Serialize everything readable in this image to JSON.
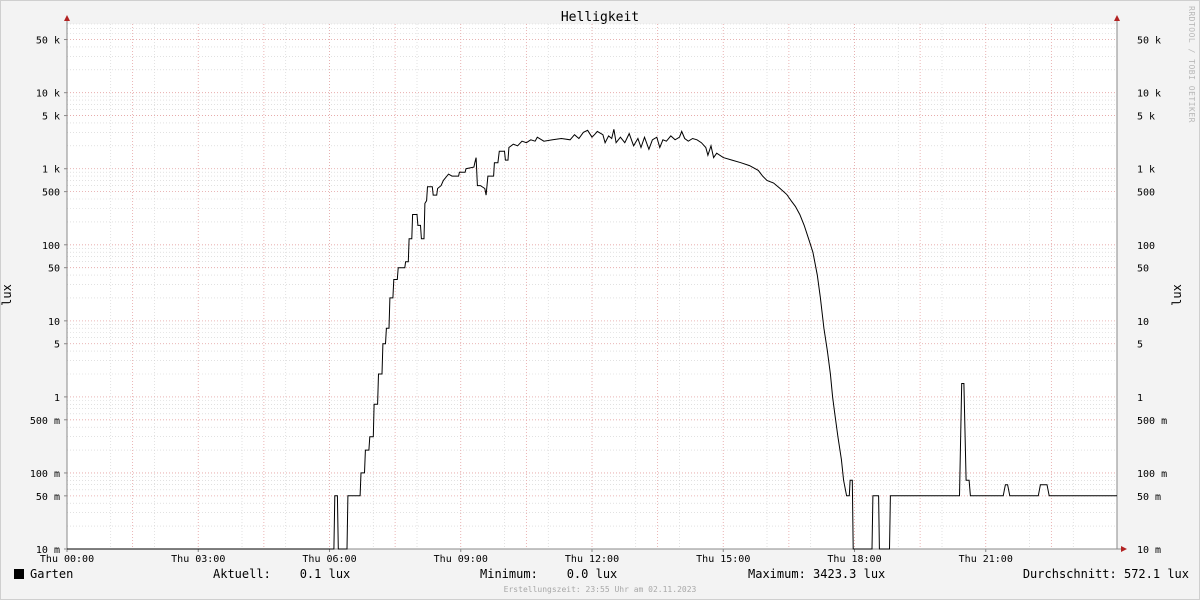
{
  "chart_data": {
    "type": "line",
    "title": "Helligkeit",
    "ylabel": "lux",
    "xlabel": "",
    "yscale": "log",
    "ylim": [
      0.01,
      80000
    ],
    "xlim": [
      0,
      24
    ],
    "x_ticks": [
      {
        "x": 0,
        "label": "Thu 00:00"
      },
      {
        "x": 3,
        "label": "Thu 03:00"
      },
      {
        "x": 6,
        "label": "Thu 06:00"
      },
      {
        "x": 9,
        "label": "Thu 09:00"
      },
      {
        "x": 12,
        "label": "Thu 12:00"
      },
      {
        "x": 15,
        "label": "Thu 15:00"
      },
      {
        "x": 18,
        "label": "Thu 18:00"
      },
      {
        "x": 21,
        "label": "Thu 21:00"
      }
    ],
    "y_ticks": [
      {
        "v": 0.01,
        "label": "10 m"
      },
      {
        "v": 0.05,
        "label": "50 m"
      },
      {
        "v": 0.1,
        "label": "100 m"
      },
      {
        "v": 0.5,
        "label": "500 m"
      },
      {
        "v": 1,
        "label": "1"
      },
      {
        "v": 5,
        "label": "5"
      },
      {
        "v": 10,
        "label": "10"
      },
      {
        "v": 50,
        "label": "50"
      },
      {
        "v": 100,
        "label": "100"
      },
      {
        "v": 500,
        "label": "500"
      },
      {
        "v": 1000,
        "label": "1 k"
      },
      {
        "v": 5000,
        "label": "5 k"
      },
      {
        "v": 10000,
        "label": "10 k"
      },
      {
        "v": 50000,
        "label": "50 k"
      }
    ],
    "grid": true,
    "series": [
      {
        "name": "Garten",
        "color": "#000000",
        "points": [
          [
            0.0,
            0.01
          ],
          [
            6.1,
            0.01
          ],
          [
            6.12,
            0.05
          ],
          [
            6.18,
            0.05
          ],
          [
            6.2,
            0.01
          ],
          [
            6.4,
            0.01
          ],
          [
            6.42,
            0.05
          ],
          [
            6.7,
            0.05
          ],
          [
            6.72,
            0.1
          ],
          [
            6.8,
            0.1
          ],
          [
            6.82,
            0.2
          ],
          [
            6.9,
            0.2
          ],
          [
            6.92,
            0.3
          ],
          [
            7.0,
            0.3
          ],
          [
            7.02,
            0.8
          ],
          [
            7.1,
            0.8
          ],
          [
            7.12,
            2
          ],
          [
            7.2,
            2
          ],
          [
            7.22,
            5
          ],
          [
            7.28,
            5
          ],
          [
            7.3,
            8
          ],
          [
            7.36,
            8
          ],
          [
            7.38,
            20
          ],
          [
            7.45,
            20
          ],
          [
            7.47,
            35
          ],
          [
            7.55,
            35
          ],
          [
            7.57,
            50
          ],
          [
            7.72,
            50
          ],
          [
            7.74,
            60
          ],
          [
            7.8,
            60
          ],
          [
            7.82,
            120
          ],
          [
            7.88,
            120
          ],
          [
            7.9,
            250
          ],
          [
            8.0,
            250
          ],
          [
            8.02,
            180
          ],
          [
            8.08,
            180
          ],
          [
            8.1,
            120
          ],
          [
            8.16,
            120
          ],
          [
            8.18,
            350
          ],
          [
            8.22,
            380
          ],
          [
            8.24,
            580
          ],
          [
            8.35,
            580
          ],
          [
            8.37,
            450
          ],
          [
            8.45,
            450
          ],
          [
            8.47,
            550
          ],
          [
            8.55,
            600
          ],
          [
            8.6,
            700
          ],
          [
            8.72,
            850
          ],
          [
            8.8,
            800
          ],
          [
            8.95,
            800
          ],
          [
            8.97,
            900
          ],
          [
            9.1,
            900
          ],
          [
            9.12,
            1000
          ],
          [
            9.3,
            1050
          ],
          [
            9.32,
            1200
          ],
          [
            9.35,
            1400
          ],
          [
            9.38,
            600
          ],
          [
            9.45,
            600
          ],
          [
            9.55,
            550
          ],
          [
            9.58,
            450
          ],
          [
            9.62,
            800
          ],
          [
            9.75,
            800
          ],
          [
            9.77,
            1200
          ],
          [
            9.85,
            1200
          ],
          [
            9.88,
            1700
          ],
          [
            10.0,
            1700
          ],
          [
            10.02,
            1300
          ],
          [
            10.08,
            1300
          ],
          [
            10.1,
            1900
          ],
          [
            10.2,
            2100
          ],
          [
            10.3,
            2000
          ],
          [
            10.4,
            2300
          ],
          [
            10.5,
            2200
          ],
          [
            10.6,
            2400
          ],
          [
            10.7,
            2300
          ],
          [
            10.75,
            2600
          ],
          [
            10.9,
            2300
          ],
          [
            11.1,
            2400
          ],
          [
            11.3,
            2500
          ],
          [
            11.5,
            2400
          ],
          [
            11.6,
            2800
          ],
          [
            11.7,
            2500
          ],
          [
            11.8,
            3000
          ],
          [
            11.9,
            3200
          ],
          [
            12.0,
            2600
          ],
          [
            12.08,
            2900
          ],
          [
            12.12,
            3100
          ],
          [
            12.25,
            2800
          ],
          [
            12.3,
            2200
          ],
          [
            12.38,
            2700
          ],
          [
            12.45,
            2500
          ],
          [
            12.5,
            3300
          ],
          [
            12.55,
            2200
          ],
          [
            12.65,
            2600
          ],
          [
            12.75,
            2200
          ],
          [
            12.85,
            2900
          ],
          [
            12.95,
            2000
          ],
          [
            13.05,
            2500
          ],
          [
            13.12,
            1900
          ],
          [
            13.2,
            2600
          ],
          [
            13.3,
            1800
          ],
          [
            13.38,
            2400
          ],
          [
            13.48,
            2600
          ],
          [
            13.55,
            1900
          ],
          [
            13.62,
            2400
          ],
          [
            13.7,
            2300
          ],
          [
            13.8,
            2700
          ],
          [
            13.9,
            2400
          ],
          [
            14.0,
            2600
          ],
          [
            14.05,
            3100
          ],
          [
            14.12,
            2500
          ],
          [
            14.2,
            2300
          ],
          [
            14.3,
            2500
          ],
          [
            14.4,
            2400
          ],
          [
            14.5,
            2200
          ],
          [
            14.6,
            1900
          ],
          [
            14.65,
            1500
          ],
          [
            14.72,
            2000
          ],
          [
            14.78,
            1400
          ],
          [
            14.85,
            1600
          ],
          [
            15.0,
            1400
          ],
          [
            15.2,
            1300
          ],
          [
            15.4,
            1200
          ],
          [
            15.6,
            1100
          ],
          [
            15.8,
            950
          ],
          [
            15.9,
            800
          ],
          [
            16.0,
            700
          ],
          [
            16.15,
            650
          ],
          [
            16.3,
            550
          ],
          [
            16.45,
            460
          ],
          [
            16.55,
            380
          ],
          [
            16.65,
            320
          ],
          [
            16.75,
            250
          ],
          [
            16.85,
            180
          ],
          [
            16.95,
            120
          ],
          [
            17.05,
            80
          ],
          [
            17.15,
            40
          ],
          [
            17.22,
            20
          ],
          [
            17.3,
            8
          ],
          [
            17.38,
            4
          ],
          [
            17.45,
            2
          ],
          [
            17.5,
            1
          ],
          [
            17.55,
            0.6
          ],
          [
            17.62,
            0.3
          ],
          [
            17.7,
            0.15
          ],
          [
            17.75,
            0.08
          ],
          [
            17.82,
            0.05
          ],
          [
            17.88,
            0.05
          ],
          [
            17.9,
            0.08
          ],
          [
            17.95,
            0.08
          ],
          [
            17.97,
            0.01
          ],
          [
            18.4,
            0.01
          ],
          [
            18.42,
            0.05
          ],
          [
            18.55,
            0.05
          ],
          [
            18.57,
            0.01
          ],
          [
            18.8,
            0.01
          ],
          [
            18.82,
            0.05
          ],
          [
            20.4,
            0.05
          ],
          [
            20.45,
            1.5
          ],
          [
            20.5,
            1.5
          ],
          [
            20.55,
            0.08
          ],
          [
            20.62,
            0.08
          ],
          [
            20.65,
            0.05
          ],
          [
            21.4,
            0.05
          ],
          [
            21.45,
            0.07
          ],
          [
            21.5,
            0.07
          ],
          [
            21.55,
            0.05
          ],
          [
            22.2,
            0.05
          ],
          [
            22.25,
            0.07
          ],
          [
            22.4,
            0.07
          ],
          [
            22.45,
            0.05
          ],
          [
            24.0,
            0.05
          ]
        ]
      }
    ],
    "legend": {
      "name": "Garten",
      "aktuell": "Aktuell:    0.1 lux",
      "minimum": "Minimum:    0.0 lux",
      "maximum": "Maximum: 3423.3 lux",
      "durchschnitt": "Durchschnitt: 572.1 lux"
    },
    "colors": {
      "major_grid": "#e7a3a3",
      "minor_grid": "#cfcfcf",
      "axis_arrow": "#b22222",
      "line": "#000000"
    }
  },
  "watermark": "RRDTOOL / TOBI OETIKER",
  "footer": "Erstellungszeit: 23:55 Uhr am 02.11.2023"
}
